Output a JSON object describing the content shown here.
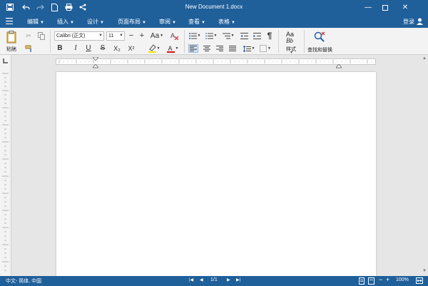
{
  "app": {
    "title": "New Document 1.docx",
    "login_label": "登录"
  },
  "menu": {
    "items": [
      {
        "label": "编辑"
      },
      {
        "label": "插入"
      },
      {
        "label": "设计"
      },
      {
        "label": "页面布局"
      },
      {
        "label": "审阅"
      },
      {
        "label": "查看"
      },
      {
        "label": "表格"
      }
    ]
  },
  "ribbon": {
    "paste_label": "粘贴",
    "font_name": "Calibri (正文)",
    "font_size": "11",
    "styles_label": "样式",
    "styles_preview_top": "Aa",
    "styles_preview_bottom": "Bb",
    "find_replace_label": "查找和替换",
    "bold": "B",
    "italic": "I",
    "underline": "U",
    "strike": "S",
    "subscript": "X₂",
    "superscript": "X²",
    "change_case": "Aa",
    "font_color": "A",
    "size_minus": "−",
    "size_plus": "+",
    "pilcrow": "¶",
    "highlight_color": "#f2e600",
    "font_color_value": "#e01010"
  },
  "status": {
    "language": "中文- 简体, 中国",
    "page_indicator": "1/1",
    "zoom": "100%"
  },
  "colors": {
    "chrome": "#1f5f9a",
    "ribbon_bg": "#f3f3f3",
    "workspace": "#e6e6e6"
  }
}
